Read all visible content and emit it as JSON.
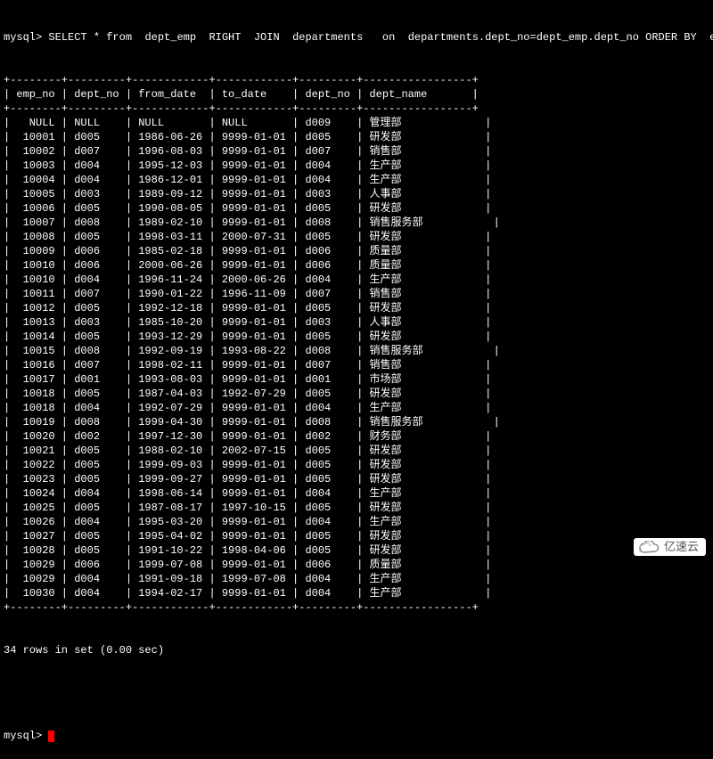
{
  "prompt_prefix": "mysql> ",
  "query": "SELECT * from  dept_emp  RIGHT  JOIN  departments   on  departments.dept_no=dept_emp.dept_no ORDER BY  emp_",
  "columns": [
    "emp_no",
    "dept_no",
    "from_date",
    "to_date",
    "dept_no",
    "dept_name"
  ],
  "rows": [
    {
      "emp_no": "NULL",
      "dept_no1": "NULL",
      "from_date": "NULL",
      "to_date": "NULL",
      "dept_no2": "d009",
      "dept_name": "管理部"
    },
    {
      "emp_no": "10001",
      "dept_no1": "d005",
      "from_date": "1986-06-26",
      "to_date": "9999-01-01",
      "dept_no2": "d005",
      "dept_name": "研发部"
    },
    {
      "emp_no": "10002",
      "dept_no1": "d007",
      "from_date": "1996-08-03",
      "to_date": "9999-01-01",
      "dept_no2": "d007",
      "dept_name": "销售部"
    },
    {
      "emp_no": "10003",
      "dept_no1": "d004",
      "from_date": "1995-12-03",
      "to_date": "9999-01-01",
      "dept_no2": "d004",
      "dept_name": "生产部"
    },
    {
      "emp_no": "10004",
      "dept_no1": "d004",
      "from_date": "1986-12-01",
      "to_date": "9999-01-01",
      "dept_no2": "d004",
      "dept_name": "生产部"
    },
    {
      "emp_no": "10005",
      "dept_no1": "d003",
      "from_date": "1989-09-12",
      "to_date": "9999-01-01",
      "dept_no2": "d003",
      "dept_name": "人事部"
    },
    {
      "emp_no": "10006",
      "dept_no1": "d005",
      "from_date": "1990-08-05",
      "to_date": "9999-01-01",
      "dept_no2": "d005",
      "dept_name": "研发部"
    },
    {
      "emp_no": "10007",
      "dept_no1": "d008",
      "from_date": "1989-02-10",
      "to_date": "9999-01-01",
      "dept_no2": "d008",
      "dept_name": "销售服务部"
    },
    {
      "emp_no": "10008",
      "dept_no1": "d005",
      "from_date": "1998-03-11",
      "to_date": "2000-07-31",
      "dept_no2": "d005",
      "dept_name": "研发部"
    },
    {
      "emp_no": "10009",
      "dept_no1": "d006",
      "from_date": "1985-02-18",
      "to_date": "9999-01-01",
      "dept_no2": "d006",
      "dept_name": "质量部"
    },
    {
      "emp_no": "10010",
      "dept_no1": "d006",
      "from_date": "2000-06-26",
      "to_date": "9999-01-01",
      "dept_no2": "d006",
      "dept_name": "质量部"
    },
    {
      "emp_no": "10010",
      "dept_no1": "d004",
      "from_date": "1996-11-24",
      "to_date": "2000-06-26",
      "dept_no2": "d004",
      "dept_name": "生产部"
    },
    {
      "emp_no": "10011",
      "dept_no1": "d007",
      "from_date": "1990-01-22",
      "to_date": "1996-11-09",
      "dept_no2": "d007",
      "dept_name": "销售部"
    },
    {
      "emp_no": "10012",
      "dept_no1": "d005",
      "from_date": "1992-12-18",
      "to_date": "9999-01-01",
      "dept_no2": "d005",
      "dept_name": "研发部"
    },
    {
      "emp_no": "10013",
      "dept_no1": "d003",
      "from_date": "1985-10-20",
      "to_date": "9999-01-01",
      "dept_no2": "d003",
      "dept_name": "人事部"
    },
    {
      "emp_no": "10014",
      "dept_no1": "d005",
      "from_date": "1993-12-29",
      "to_date": "9999-01-01",
      "dept_no2": "d005",
      "dept_name": "研发部"
    },
    {
      "emp_no": "10015",
      "dept_no1": "d008",
      "from_date": "1992-09-19",
      "to_date": "1993-08-22",
      "dept_no2": "d008",
      "dept_name": "销售服务部"
    },
    {
      "emp_no": "10016",
      "dept_no1": "d007",
      "from_date": "1998-02-11",
      "to_date": "9999-01-01",
      "dept_no2": "d007",
      "dept_name": "销售部"
    },
    {
      "emp_no": "10017",
      "dept_no1": "d001",
      "from_date": "1993-08-03",
      "to_date": "9999-01-01",
      "dept_no2": "d001",
      "dept_name": "市场部"
    },
    {
      "emp_no": "10018",
      "dept_no1": "d005",
      "from_date": "1987-04-03",
      "to_date": "1992-07-29",
      "dept_no2": "d005",
      "dept_name": "研发部"
    },
    {
      "emp_no": "10018",
      "dept_no1": "d004",
      "from_date": "1992-07-29",
      "to_date": "9999-01-01",
      "dept_no2": "d004",
      "dept_name": "生产部"
    },
    {
      "emp_no": "10019",
      "dept_no1": "d008",
      "from_date": "1999-04-30",
      "to_date": "9999-01-01",
      "dept_no2": "d008",
      "dept_name": "销售服务部"
    },
    {
      "emp_no": "10020",
      "dept_no1": "d002",
      "from_date": "1997-12-30",
      "to_date": "9999-01-01",
      "dept_no2": "d002",
      "dept_name": "财务部"
    },
    {
      "emp_no": "10021",
      "dept_no1": "d005",
      "from_date": "1988-02-10",
      "to_date": "2002-07-15",
      "dept_no2": "d005",
      "dept_name": "研发部"
    },
    {
      "emp_no": "10022",
      "dept_no1": "d005",
      "from_date": "1999-09-03",
      "to_date": "9999-01-01",
      "dept_no2": "d005",
      "dept_name": "研发部"
    },
    {
      "emp_no": "10023",
      "dept_no1": "d005",
      "from_date": "1999-09-27",
      "to_date": "9999-01-01",
      "dept_no2": "d005",
      "dept_name": "研发部"
    },
    {
      "emp_no": "10024",
      "dept_no1": "d004",
      "from_date": "1998-06-14",
      "to_date": "9999-01-01",
      "dept_no2": "d004",
      "dept_name": "生产部"
    },
    {
      "emp_no": "10025",
      "dept_no1": "d005",
      "from_date": "1987-08-17",
      "to_date": "1997-10-15",
      "dept_no2": "d005",
      "dept_name": "研发部"
    },
    {
      "emp_no": "10026",
      "dept_no1": "d004",
      "from_date": "1995-03-20",
      "to_date": "9999-01-01",
      "dept_no2": "d004",
      "dept_name": "生产部"
    },
    {
      "emp_no": "10027",
      "dept_no1": "d005",
      "from_date": "1995-04-02",
      "to_date": "9999-01-01",
      "dept_no2": "d005",
      "dept_name": "研发部"
    },
    {
      "emp_no": "10028",
      "dept_no1": "d005",
      "from_date": "1991-10-22",
      "to_date": "1998-04-06",
      "dept_no2": "d005",
      "dept_name": "研发部"
    },
    {
      "emp_no": "10029",
      "dept_no1": "d006",
      "from_date": "1999-07-08",
      "to_date": "9999-01-01",
      "dept_no2": "d006",
      "dept_name": "质量部"
    },
    {
      "emp_no": "10029",
      "dept_no1": "d004",
      "from_date": "1991-09-18",
      "to_date": "1999-07-08",
      "dept_no2": "d004",
      "dept_name": "生产部"
    },
    {
      "emp_no": "10030",
      "dept_no1": "d004",
      "from_date": "1994-02-17",
      "to_date": "9999-01-01",
      "dept_no2": "d004",
      "dept_name": "生产部"
    }
  ],
  "status_line": "34 rows in set (0.00 sec)",
  "final_prompt": "mysql> ",
  "watermark_text": "亿速云",
  "col_widths": {
    "emp_no": 8,
    "dept_no1": 9,
    "from_date": 12,
    "to_date": 12,
    "dept_no2": 9,
    "dept_name": 17
  }
}
